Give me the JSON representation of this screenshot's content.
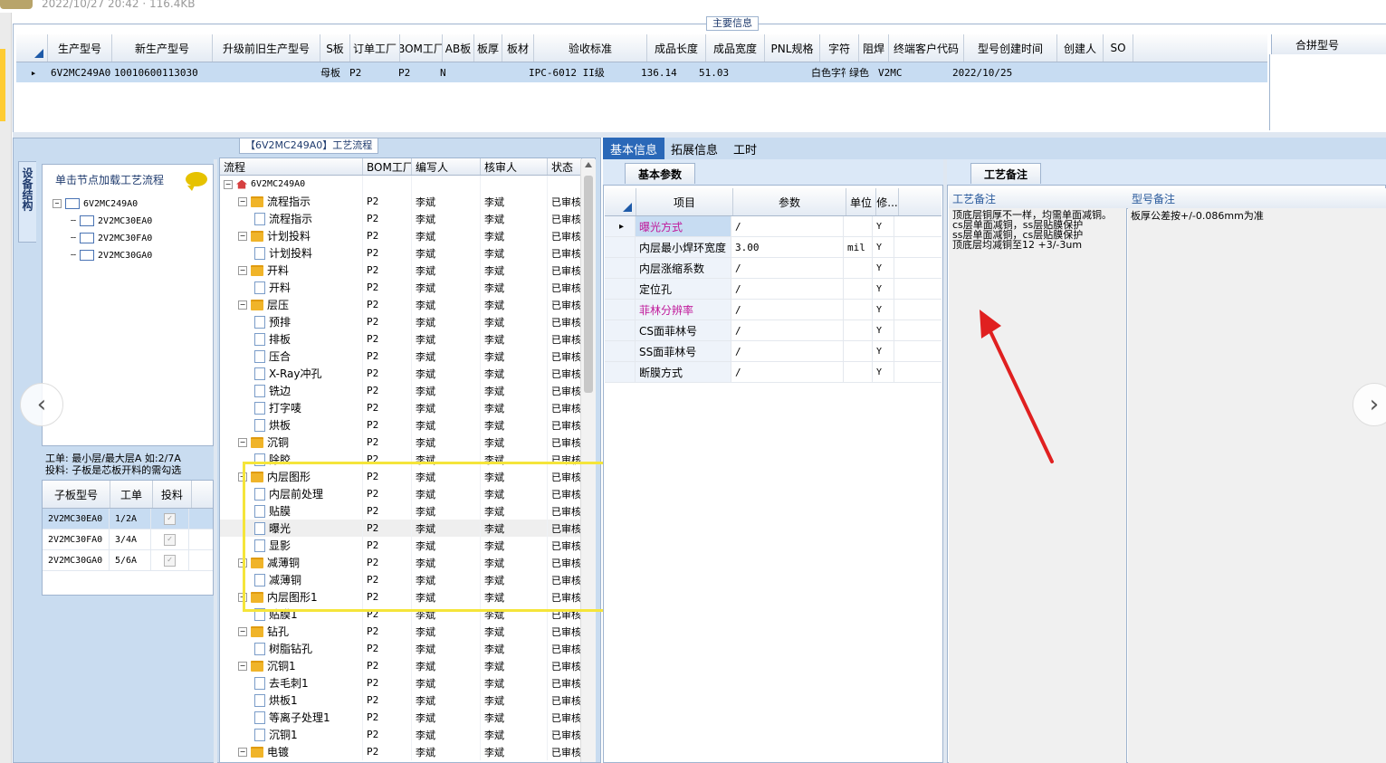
{
  "viewer": {
    "meta": "2022/10/27 20:42 · 116.4KB"
  },
  "main_info": {
    "group_title": "主要信息",
    "columns": [
      "生产型号",
      "新生产型号",
      "升级前旧生产型号",
      "S板",
      "订单工厂",
      "BOM工厂",
      "AB板",
      "板厚",
      "板材",
      "验收标准",
      "成品长度",
      "成品宽度",
      "PNL规格",
      "字符",
      "阻焊",
      "终端客户代码",
      "型号创建时间",
      "创建人",
      "SO"
    ],
    "row": [
      "6V2MC249A0",
      "10010600113030",
      "",
      "母板",
      "P2",
      "P2",
      "N",
      "",
      "",
      "IPC-6012 II级",
      "136.14",
      "51.03",
      "",
      "白色字符",
      "绿色",
      "V2MC",
      "2022/10/25",
      "",
      ""
    ],
    "merge_col": "合拼型号"
  },
  "flow": {
    "title": "【6V2MC249A0】工艺流程",
    "side_tab": "设备结构",
    "hint": "单击节点加载工艺流程",
    "tree": [
      {
        "label": "6V2MC249A0",
        "level": 0
      },
      {
        "label": "2V2MC30EA0",
        "level": 1
      },
      {
        "label": "2V2MC30FA0",
        "level": 1
      },
      {
        "label": "2V2MC30GA0",
        "level": 1
      }
    ],
    "note_line1": "工单: 最小层/最大层A 如:2/7A",
    "note_line2": "投料: 子板是芯板开料的需勾选",
    "sub_columns": [
      "子板型号",
      "工单",
      "投料"
    ],
    "sub_rows": [
      {
        "model": "2V2MC30EA0",
        "order": "1/2A",
        "check": "✓"
      },
      {
        "model": "2V2MC30FA0",
        "order": "3/4A",
        "check": "✓"
      },
      {
        "model": "2V2MC30GA0",
        "order": "5/6A",
        "check": "✓"
      }
    ]
  },
  "process": {
    "columns": [
      "流程",
      "BOM工厂",
      "编写人",
      "核审人",
      "状态"
    ],
    "rows": [
      {
        "name": "6V2MC249A0",
        "type": "root",
        "bom": "",
        "writer": "",
        "reviewer": "",
        "status": ""
      },
      {
        "name": "流程指示",
        "type": "group",
        "bom": "P2",
        "writer": "李斌",
        "reviewer": "李斌",
        "status": "已审核"
      },
      {
        "name": "流程指示",
        "type": "leaf",
        "bom": "P2",
        "writer": "李斌",
        "reviewer": "李斌",
        "status": "已审核"
      },
      {
        "name": "计划投料",
        "type": "group",
        "bom": "P2",
        "writer": "李斌",
        "reviewer": "李斌",
        "status": "已审核"
      },
      {
        "name": "计划投料",
        "type": "leaf",
        "bom": "P2",
        "writer": "李斌",
        "reviewer": "李斌",
        "status": "已审核"
      },
      {
        "name": "开料",
        "type": "group",
        "bom": "P2",
        "writer": "李斌",
        "reviewer": "李斌",
        "status": "已审核"
      },
      {
        "name": "开料",
        "type": "leaf",
        "bom": "P2",
        "writer": "李斌",
        "reviewer": "李斌",
        "status": "已审核"
      },
      {
        "name": "层压",
        "type": "group",
        "bom": "P2",
        "writer": "李斌",
        "reviewer": "李斌",
        "status": "已审核"
      },
      {
        "name": "预排",
        "type": "leaf",
        "bom": "P2",
        "writer": "李斌",
        "reviewer": "李斌",
        "status": "已审核"
      },
      {
        "name": "排板",
        "type": "leaf",
        "bom": "P2",
        "writer": "李斌",
        "reviewer": "李斌",
        "status": "已审核"
      },
      {
        "name": "压合",
        "type": "leaf",
        "bom": "P2",
        "writer": "李斌",
        "reviewer": "李斌",
        "status": "已审核"
      },
      {
        "name": "X-Ray冲孔",
        "type": "leaf",
        "bom": "P2",
        "writer": "李斌",
        "reviewer": "李斌",
        "status": "已审核"
      },
      {
        "name": "铣边",
        "type": "leaf",
        "bom": "P2",
        "writer": "李斌",
        "reviewer": "李斌",
        "status": "已审核"
      },
      {
        "name": "打字唛",
        "type": "leaf",
        "bom": "P2",
        "writer": "李斌",
        "reviewer": "李斌",
        "status": "已审核"
      },
      {
        "name": "烘板",
        "type": "leaf",
        "bom": "P2",
        "writer": "李斌",
        "reviewer": "李斌",
        "status": "已审核"
      },
      {
        "name": "沉铜",
        "type": "group",
        "bom": "P2",
        "writer": "李斌",
        "reviewer": "李斌",
        "status": "已审核"
      },
      {
        "name": "除胶",
        "type": "leaf",
        "bom": "P2",
        "writer": "李斌",
        "reviewer": "李斌",
        "status": "已审核"
      },
      {
        "name": "内层图形",
        "type": "group",
        "bom": "P2",
        "writer": "李斌",
        "reviewer": "李斌",
        "status": "已审核"
      },
      {
        "name": "内层前处理",
        "type": "leaf",
        "bom": "P2",
        "writer": "李斌",
        "reviewer": "李斌",
        "status": "已审核"
      },
      {
        "name": "贴膜",
        "type": "leaf",
        "bom": "P2",
        "writer": "李斌",
        "reviewer": "李斌",
        "status": "已审核"
      },
      {
        "name": "曝光",
        "type": "leaf",
        "bom": "P2",
        "writer": "李斌",
        "reviewer": "李斌",
        "status": "已审核",
        "selected": true
      },
      {
        "name": "显影",
        "type": "leaf",
        "bom": "P2",
        "writer": "李斌",
        "reviewer": "李斌",
        "status": "已审核"
      },
      {
        "name": "减薄铜",
        "type": "group",
        "bom": "P2",
        "writer": "李斌",
        "reviewer": "李斌",
        "status": "已审核"
      },
      {
        "name": "减薄铜",
        "type": "leaf",
        "bom": "P2",
        "writer": "李斌",
        "reviewer": "李斌",
        "status": "已审核"
      },
      {
        "name": "内层图形1",
        "type": "group",
        "bom": "P2",
        "writer": "李斌",
        "reviewer": "李斌",
        "status": "已审核"
      },
      {
        "name": "贴膜1",
        "type": "leaf",
        "bom": "P2",
        "writer": "李斌",
        "reviewer": "李斌",
        "status": "已审核"
      },
      {
        "name": "钻孔",
        "type": "group",
        "bom": "P2",
        "writer": "李斌",
        "reviewer": "李斌",
        "status": "已审核"
      },
      {
        "name": "树脂钻孔",
        "type": "leaf",
        "bom": "P2",
        "writer": "李斌",
        "reviewer": "李斌",
        "status": "已审核"
      },
      {
        "name": "沉铜1",
        "type": "group",
        "bom": "P2",
        "writer": "李斌",
        "reviewer": "李斌",
        "status": "已审核"
      },
      {
        "name": "去毛刺1",
        "type": "leaf",
        "bom": "P2",
        "writer": "李斌",
        "reviewer": "李斌",
        "status": "已审核"
      },
      {
        "name": "烘板1",
        "type": "leaf",
        "bom": "P2",
        "writer": "李斌",
        "reviewer": "李斌",
        "status": "已审核"
      },
      {
        "name": "等离子处理1",
        "type": "leaf",
        "bom": "P2",
        "writer": "李斌",
        "reviewer": "李斌",
        "status": "已审核"
      },
      {
        "name": "沉铜1",
        "type": "leaf",
        "bom": "P2",
        "writer": "李斌",
        "reviewer": "李斌",
        "status": "已审核"
      },
      {
        "name": "电镀",
        "type": "group",
        "bom": "P2",
        "writer": "李斌",
        "reviewer": "李斌",
        "status": "已审核"
      }
    ]
  },
  "right_tabs": [
    "基本信息",
    "拓展信息",
    "工时"
  ],
  "basic": {
    "tab": "基本参数",
    "columns": [
      "项目",
      "参数",
      "单位",
      "修..."
    ],
    "rows": [
      {
        "item": "曝光方式",
        "value": "/",
        "unit": "",
        "mod": "Y",
        "magenta": true
      },
      {
        "item": "内层最小焊环宽度",
        "value": "3.00",
        "unit": "mil",
        "mod": "Y",
        "magenta": false
      },
      {
        "item": "内层涨缩系数",
        "value": "/",
        "unit": "",
        "mod": "Y",
        "magenta": false
      },
      {
        "item": "定位孔",
        "value": "/",
        "unit": "",
        "mod": "Y",
        "magenta": false
      },
      {
        "item": "菲林分辨率",
        "value": "/",
        "unit": "",
        "mod": "Y",
        "magenta": true
      },
      {
        "item": "CS面菲林号",
        "value": "/",
        "unit": "",
        "mod": "Y",
        "magenta": false
      },
      {
        "item": "SS面菲林号",
        "value": "/",
        "unit": "",
        "mod": "Y",
        "magenta": false
      },
      {
        "item": "断膜方式",
        "value": "/",
        "unit": "",
        "mod": "Y",
        "magenta": false
      }
    ]
  },
  "remarks": {
    "tab": "工艺备注",
    "col1": "工艺备注",
    "col2": "型号备注",
    "process_remark": [
      "顶底层铜厚不一样，均需单面减铜。",
      "cs层单面减铜，ss层贴膜保护",
      "ss层单面减铜，cs层贴膜保护",
      "顶底层均减铜至12 +3/-3um"
    ],
    "model_remark": "板厚公差按+/-0.086mm为准"
  },
  "colors": {
    "accent": "#2a68b8",
    "selection": "#c7dcf2",
    "highlight_box": "#f5e53a",
    "arrow": "#e02020",
    "magenta_text": "#c0189a"
  }
}
